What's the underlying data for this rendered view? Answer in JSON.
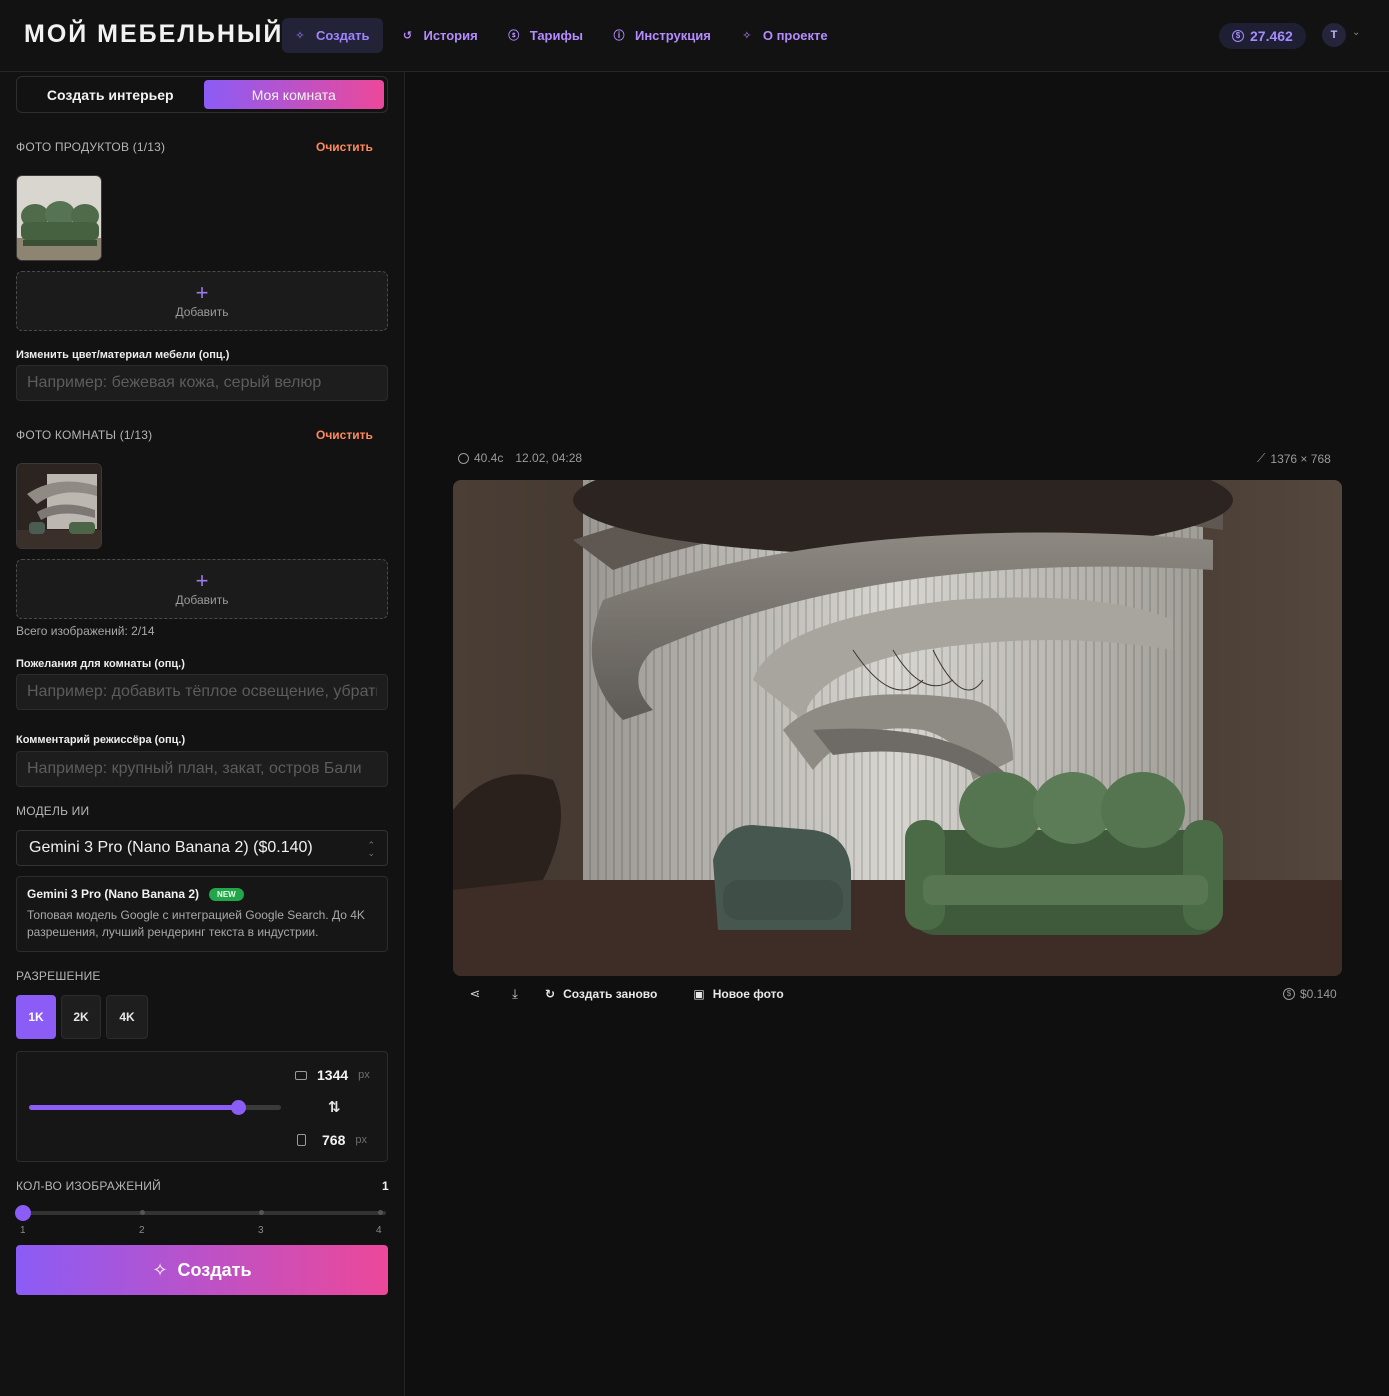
{
  "header": {
    "logo": "МОЙ МЕБЕЛЬНЫЙ",
    "nav": [
      {
        "label": "Создать",
        "icon": "sparkles-icon",
        "active": true
      },
      {
        "label": "История",
        "icon": "history-icon",
        "active": false
      },
      {
        "label": "Тарифы",
        "icon": "dollar-circle-icon",
        "active": false
      },
      {
        "label": "Инструкция",
        "icon": "info-icon",
        "active": false
      },
      {
        "label": "О проекте",
        "icon": "sparkles-icon",
        "active": false
      }
    ],
    "balance": "27.462",
    "avatar_initial": "T"
  },
  "sidebar": {
    "mode_tabs": [
      {
        "label": "Создать интерьер",
        "active": false
      },
      {
        "label": "Моя комната",
        "active": true
      }
    ],
    "product_photos": {
      "label": "ФОТО ПРОДУКТОВ (1/13)",
      "clear": "Очистить",
      "add": "Добавить"
    },
    "color_material": {
      "label": "Изменить цвет/материал мебели (опц.)",
      "placeholder": "Например: бежевая кожа, серый велюр"
    },
    "room_photos": {
      "label": "ФОТО КОМНАТЫ (1/13)",
      "clear": "Очистить",
      "add": "Добавить"
    },
    "total_images": "Всего изображений: 2/14",
    "room_wishes": {
      "label": "Пожелания для комнаты (опц.)",
      "placeholder": "Например: добавить тёплое освещение, убрать"
    },
    "director_comment": {
      "label": "Комментарий режиссёра (опц.)",
      "placeholder": "Например: крупный план, закат, остров Бали"
    },
    "model": {
      "label": "МОДЕЛЬ ИИ",
      "selected": "Gemini 3 Pro (Nano Banana 2) ($0.140)",
      "card_title": "Gemini 3 Pro (Nano Banana 2)",
      "badge": "NEW",
      "description": "Топовая модель Google с интеграцией Google Search. До 4K разрешения, лучший рендеринг текста в индустрии."
    },
    "resolution": {
      "label": "РАЗРЕШЕНИЕ",
      "options": [
        "1K",
        "2K",
        "4K"
      ],
      "selected": "1K",
      "width": "1344",
      "height": "768",
      "unit": "px",
      "slider_fraction": 0.83
    },
    "count": {
      "label": "КОЛ-ВО ИЗОБРАЖЕНИЙ",
      "value": "1",
      "ticks": [
        "1",
        "2",
        "3",
        "4"
      ]
    },
    "create_label": "Создать"
  },
  "main": {
    "duration": "40.4с",
    "datetime": "12.02, 04:28",
    "dimensions": "1376 × 768",
    "actions": {
      "regenerate": "Создать заново",
      "new_photo": "Новое фото"
    },
    "cost": "$0.140",
    "colors": {
      "accent": "#8b5cf6",
      "accent_pink": "#ec4899",
      "clear": "#ff8a5c",
      "new_badge": "#22a64a"
    }
  }
}
